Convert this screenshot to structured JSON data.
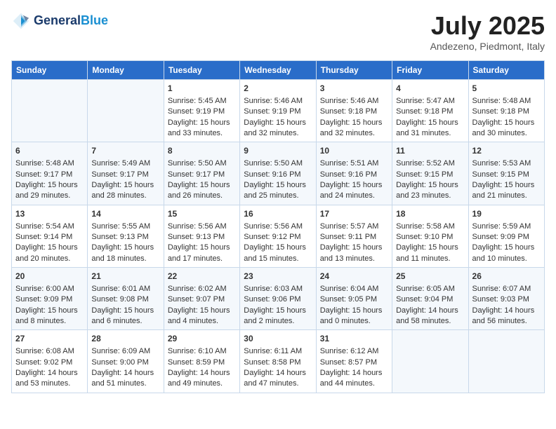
{
  "header": {
    "logo_line1": "General",
    "logo_line2": "Blue",
    "month": "July 2025",
    "location": "Andezeno, Piedmont, Italy"
  },
  "weekdays": [
    "Sunday",
    "Monday",
    "Tuesday",
    "Wednesday",
    "Thursday",
    "Friday",
    "Saturday"
  ],
  "weeks": [
    [
      {
        "day": "",
        "info": ""
      },
      {
        "day": "",
        "info": ""
      },
      {
        "day": "1",
        "info": "Sunrise: 5:45 AM\nSunset: 9:19 PM\nDaylight: 15 hours\nand 33 minutes."
      },
      {
        "day": "2",
        "info": "Sunrise: 5:46 AM\nSunset: 9:19 PM\nDaylight: 15 hours\nand 32 minutes."
      },
      {
        "day": "3",
        "info": "Sunrise: 5:46 AM\nSunset: 9:18 PM\nDaylight: 15 hours\nand 32 minutes."
      },
      {
        "day": "4",
        "info": "Sunrise: 5:47 AM\nSunset: 9:18 PM\nDaylight: 15 hours\nand 31 minutes."
      },
      {
        "day": "5",
        "info": "Sunrise: 5:48 AM\nSunset: 9:18 PM\nDaylight: 15 hours\nand 30 minutes."
      }
    ],
    [
      {
        "day": "6",
        "info": "Sunrise: 5:48 AM\nSunset: 9:17 PM\nDaylight: 15 hours\nand 29 minutes."
      },
      {
        "day": "7",
        "info": "Sunrise: 5:49 AM\nSunset: 9:17 PM\nDaylight: 15 hours\nand 28 minutes."
      },
      {
        "day": "8",
        "info": "Sunrise: 5:50 AM\nSunset: 9:17 PM\nDaylight: 15 hours\nand 26 minutes."
      },
      {
        "day": "9",
        "info": "Sunrise: 5:50 AM\nSunset: 9:16 PM\nDaylight: 15 hours\nand 25 minutes."
      },
      {
        "day": "10",
        "info": "Sunrise: 5:51 AM\nSunset: 9:16 PM\nDaylight: 15 hours\nand 24 minutes."
      },
      {
        "day": "11",
        "info": "Sunrise: 5:52 AM\nSunset: 9:15 PM\nDaylight: 15 hours\nand 23 minutes."
      },
      {
        "day": "12",
        "info": "Sunrise: 5:53 AM\nSunset: 9:15 PM\nDaylight: 15 hours\nand 21 minutes."
      }
    ],
    [
      {
        "day": "13",
        "info": "Sunrise: 5:54 AM\nSunset: 9:14 PM\nDaylight: 15 hours\nand 20 minutes."
      },
      {
        "day": "14",
        "info": "Sunrise: 5:55 AM\nSunset: 9:13 PM\nDaylight: 15 hours\nand 18 minutes."
      },
      {
        "day": "15",
        "info": "Sunrise: 5:56 AM\nSunset: 9:13 PM\nDaylight: 15 hours\nand 17 minutes."
      },
      {
        "day": "16",
        "info": "Sunrise: 5:56 AM\nSunset: 9:12 PM\nDaylight: 15 hours\nand 15 minutes."
      },
      {
        "day": "17",
        "info": "Sunrise: 5:57 AM\nSunset: 9:11 PM\nDaylight: 15 hours\nand 13 minutes."
      },
      {
        "day": "18",
        "info": "Sunrise: 5:58 AM\nSunset: 9:10 PM\nDaylight: 15 hours\nand 11 minutes."
      },
      {
        "day": "19",
        "info": "Sunrise: 5:59 AM\nSunset: 9:09 PM\nDaylight: 15 hours\nand 10 minutes."
      }
    ],
    [
      {
        "day": "20",
        "info": "Sunrise: 6:00 AM\nSunset: 9:09 PM\nDaylight: 15 hours\nand 8 minutes."
      },
      {
        "day": "21",
        "info": "Sunrise: 6:01 AM\nSunset: 9:08 PM\nDaylight: 15 hours\nand 6 minutes."
      },
      {
        "day": "22",
        "info": "Sunrise: 6:02 AM\nSunset: 9:07 PM\nDaylight: 15 hours\nand 4 minutes."
      },
      {
        "day": "23",
        "info": "Sunrise: 6:03 AM\nSunset: 9:06 PM\nDaylight: 15 hours\nand 2 minutes."
      },
      {
        "day": "24",
        "info": "Sunrise: 6:04 AM\nSunset: 9:05 PM\nDaylight: 15 hours\nand 0 minutes."
      },
      {
        "day": "25",
        "info": "Sunrise: 6:05 AM\nSunset: 9:04 PM\nDaylight: 14 hours\nand 58 minutes."
      },
      {
        "day": "26",
        "info": "Sunrise: 6:07 AM\nSunset: 9:03 PM\nDaylight: 14 hours\nand 56 minutes."
      }
    ],
    [
      {
        "day": "27",
        "info": "Sunrise: 6:08 AM\nSunset: 9:02 PM\nDaylight: 14 hours\nand 53 minutes."
      },
      {
        "day": "28",
        "info": "Sunrise: 6:09 AM\nSunset: 9:00 PM\nDaylight: 14 hours\nand 51 minutes."
      },
      {
        "day": "29",
        "info": "Sunrise: 6:10 AM\nSunset: 8:59 PM\nDaylight: 14 hours\nand 49 minutes."
      },
      {
        "day": "30",
        "info": "Sunrise: 6:11 AM\nSunset: 8:58 PM\nDaylight: 14 hours\nand 47 minutes."
      },
      {
        "day": "31",
        "info": "Sunrise: 6:12 AM\nSunset: 8:57 PM\nDaylight: 14 hours\nand 44 minutes."
      },
      {
        "day": "",
        "info": ""
      },
      {
        "day": "",
        "info": ""
      }
    ]
  ]
}
